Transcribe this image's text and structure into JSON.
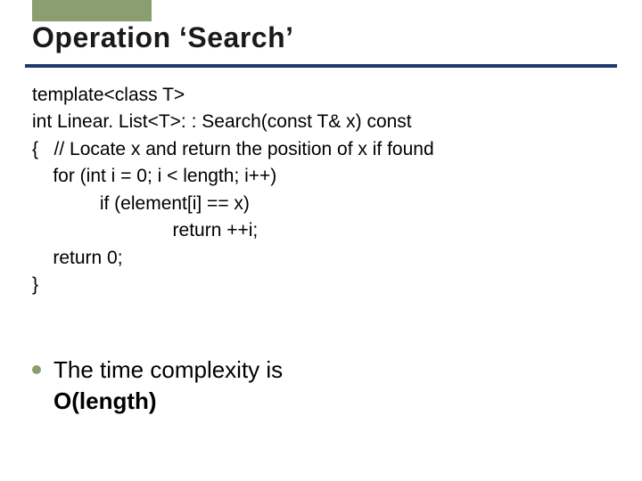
{
  "title": "Operation ‘Search’",
  "code": {
    "l1": "template<class T>",
    "l2": "int Linear. List<T>: : Search(const T& x) const",
    "l3": "{   // Locate x and return the position of x if found",
    "l4": "    for (int i = 0; i < length; i++)",
    "l5": "             if (element[i] == x)",
    "l6": "                           return ++i;",
    "l7": "    return 0;",
    "l8": "}"
  },
  "bullet": {
    "line1": "The time complexity is",
    "line2_bold": "O(length)"
  },
  "colors": {
    "accent": "#8b9e70",
    "rule": "#1f3a6e"
  }
}
